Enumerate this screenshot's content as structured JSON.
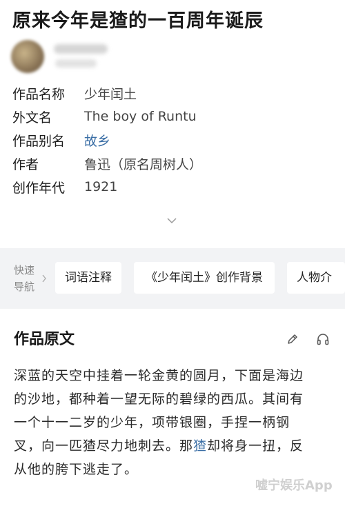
{
  "headline": "原来今年是猹的一百周年诞辰",
  "info": [
    {
      "key": "作品名称",
      "value": "少年闰土",
      "link": false
    },
    {
      "key": "外文名",
      "value": "The boy of Runtu",
      "link": false
    },
    {
      "key": "作品别名",
      "value": "故乡",
      "link": true
    },
    {
      "key": "作者",
      "value": "鲁迅（原名周树人）",
      "link": false
    },
    {
      "key": "创作年代",
      "value": "1921",
      "link": false
    }
  ],
  "quicknav": {
    "label_line1": "快速",
    "label_line2": "导航",
    "items": [
      "词语注释",
      "《少年闰土》创作背景",
      "人物介"
    ]
  },
  "section": {
    "title": "作品原文"
  },
  "body": {
    "line1": "深蓝的天空中挂着一轮金黄的圆月，下面是海边",
    "line2": "的沙地，都种着一望无际的碧绿的西瓜。其间有",
    "line3": "一个十一二岁的少年，项带银圈，手捏一柄钢",
    "line4_a": "叉，向一匹猹尽力地刺去。那",
    "line4_link": "猹",
    "line4_b": "却将身一扭，反",
    "line5": "从他的胯下逃走了。"
  },
  "watermark": "嘘宁娱乐App",
  "colors": {
    "link": "#3a6ea5",
    "nav_bg": "#f2f3f5"
  },
  "icons": [
    "chevron-down-icon",
    "chevron-right-icon",
    "edit-pencil-icon",
    "headphones-icon"
  ]
}
